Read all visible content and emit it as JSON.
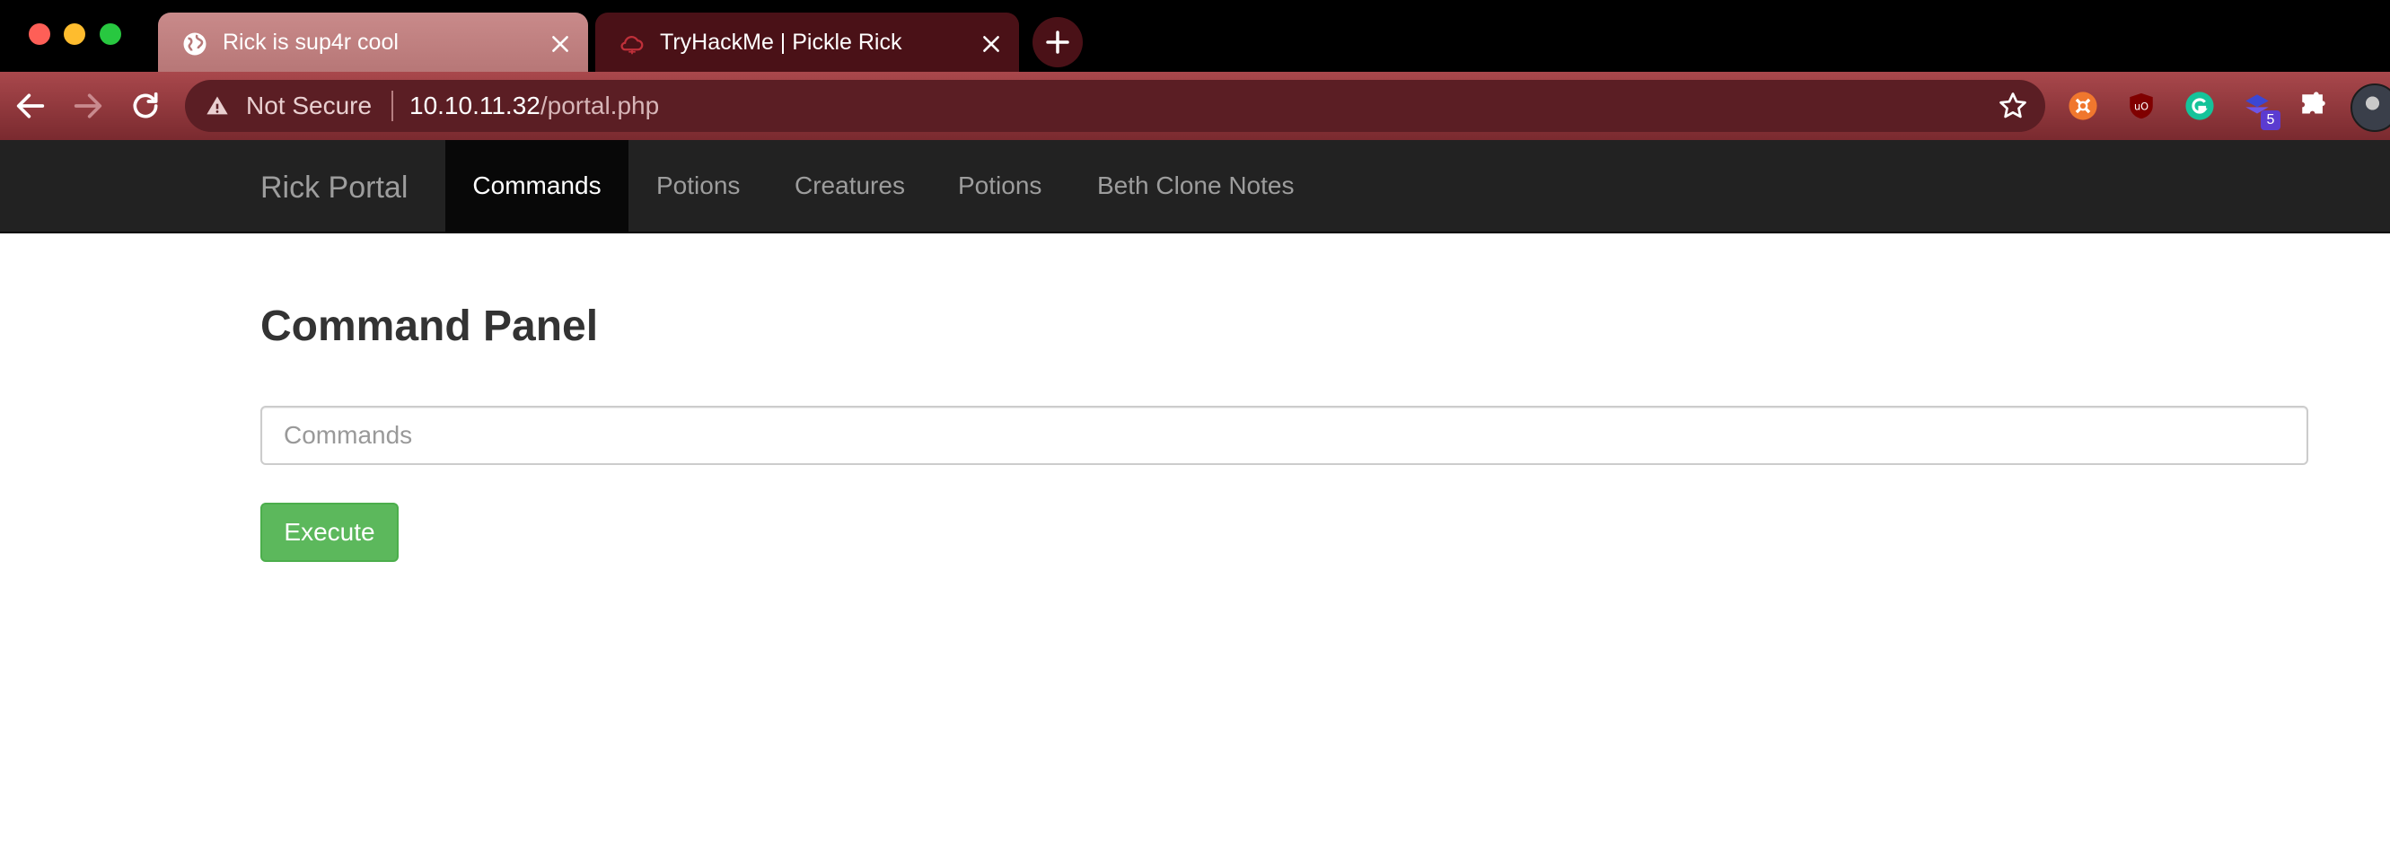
{
  "browser": {
    "tabs": [
      {
        "title": "Rick is sup4r cool",
        "favicon": "globe-icon",
        "active": true
      },
      {
        "title": "TryHackMe | Pickle Rick",
        "favicon": "cloud-icon",
        "active": false
      }
    ],
    "omnibox": {
      "security_label": "Not Secure",
      "url_host": "10.10.11.32",
      "url_path": "/portal.php"
    },
    "extension_badge": "5"
  },
  "navbar": {
    "brand": "Rick Portal",
    "items": [
      {
        "label": "Commands",
        "active": true
      },
      {
        "label": "Potions",
        "active": false
      },
      {
        "label": "Creatures",
        "active": false
      },
      {
        "label": "Potions",
        "active": false
      },
      {
        "label": "Beth Clone Notes",
        "active": false
      }
    ]
  },
  "main": {
    "title": "Command Panel",
    "command_input": {
      "placeholder": "Commands",
      "value": ""
    },
    "execute_label": "Execute"
  },
  "colors": {
    "navbar_bg": "#222222",
    "button_success": "#5cb85c",
    "toolbar_theme": "#8a3338"
  }
}
